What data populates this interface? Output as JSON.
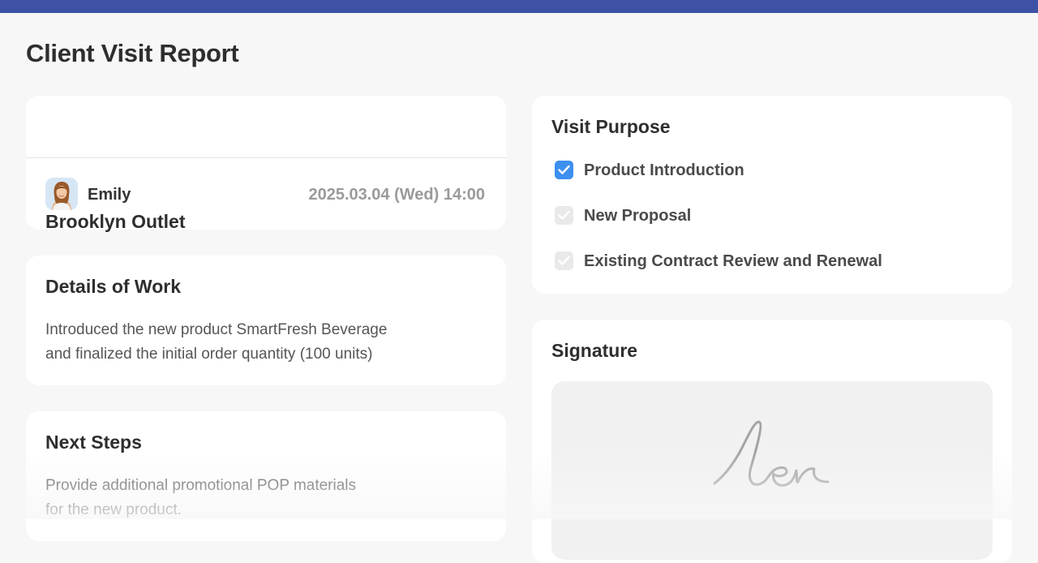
{
  "page": {
    "title": "Client Visit Report"
  },
  "visit": {
    "outlet": "Brooklyn Outlet",
    "user_name": "Emily",
    "datetime": "2025.03.04 (Wed) 14:00"
  },
  "details": {
    "title": "Details of Work",
    "line1": "Introduced the new product SmartFresh Beverage",
    "line2": "and finalized the initial order quantity (100 units)"
  },
  "next_steps": {
    "title": "Next Steps",
    "line1": "Provide additional promotional POP materials",
    "line2": "for the new product."
  },
  "purpose": {
    "title": "Visit Purpose",
    "options": [
      {
        "label": "Product Introduction",
        "checked": true
      },
      {
        "label": "New Proposal",
        "checked": false
      },
      {
        "label": "Existing Contract Review and Renewal",
        "checked": false
      }
    ]
  },
  "signature": {
    "title": "Signature"
  },
  "colors": {
    "accent": "#3d51a5",
    "checkbox_checked": "#3d8ff0",
    "background": "#f7f7f7"
  }
}
